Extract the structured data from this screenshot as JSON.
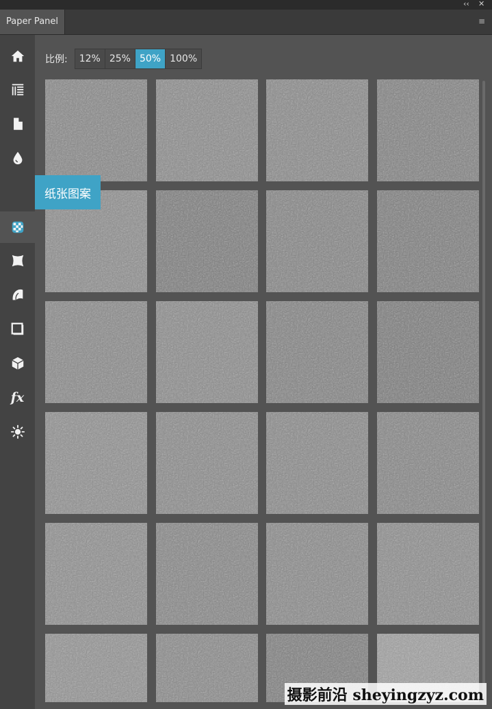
{
  "window": {
    "collapse_glyph": "‹‹",
    "close_glyph": "✕"
  },
  "tab": {
    "title": "Paper Panel",
    "menu_glyph": "≡"
  },
  "sidebar": {
    "items": [
      {
        "icon": "home-icon"
      },
      {
        "icon": "brush-lines-icon"
      },
      {
        "icon": "document-icon"
      },
      {
        "icon": "drop-icon"
      },
      {
        "icon": "paper-pattern-icon",
        "active": true
      },
      {
        "icon": "warp-icon"
      },
      {
        "icon": "paper-roll-icon"
      },
      {
        "icon": "frame-icon"
      },
      {
        "icon": "cube-icon"
      },
      {
        "icon": "fx-icon",
        "label": "fx"
      },
      {
        "icon": "light-icon"
      }
    ],
    "tooltip": "纸张图案"
  },
  "scale": {
    "label": "比例:",
    "options": [
      "12%",
      "25%",
      "50%",
      "100%"
    ],
    "selected": "50%"
  },
  "textures": {
    "rows": 6,
    "columns": 4,
    "tones": [
      [
        "#888888",
        "#8c8c8c",
        "#8a8a8a",
        "#828282"
      ],
      [
        "#8e8e8e",
        "#7d7d7d",
        "#858585",
        "#7e7e7e"
      ],
      [
        "#8a8a8a",
        "#8c8c8c",
        "#838383",
        "#7c7c7c"
      ],
      [
        "#909090",
        "#8b8b8b",
        "#8a8a8a",
        "#868686"
      ],
      [
        "#8f8f8f",
        "#878787",
        "#8a8a8a",
        "#8d8d8d"
      ],
      [
        "#939393",
        "#8a8a8a",
        "#7f7f7f",
        "#a0a0a0"
      ]
    ]
  },
  "watermark": "摄影前沿 sheyingzyz.com"
}
